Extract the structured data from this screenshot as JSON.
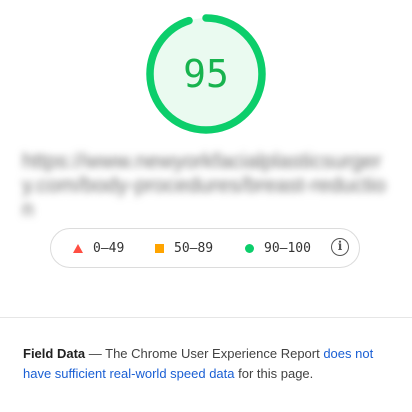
{
  "score": {
    "value": "95",
    "fraction": 0.95,
    "color": "#18b34e",
    "ring_color": "#0cce6b",
    "fill_color": "#eafaf0"
  },
  "url": {
    "text": "https://www.newyorkfacialplasticsurgery.com/body-procedures/breast-reduction",
    "blurred": true
  },
  "legend": {
    "fail": {
      "icon": "triangle-icon",
      "range": "0–49",
      "color": "#ff4e42"
    },
    "average": {
      "icon": "square-icon",
      "range": "50–89",
      "color": "#ffa400"
    },
    "pass": {
      "icon": "circle-icon",
      "range": "90–100",
      "color": "#0cce6b"
    },
    "info_glyph": "i"
  },
  "field_data": {
    "label": "Field Data",
    "separator": " — ",
    "text_before": "The Chrome User Experience Report ",
    "link_text": "does not have sufficient real-world speed data",
    "text_after": " for this page."
  }
}
